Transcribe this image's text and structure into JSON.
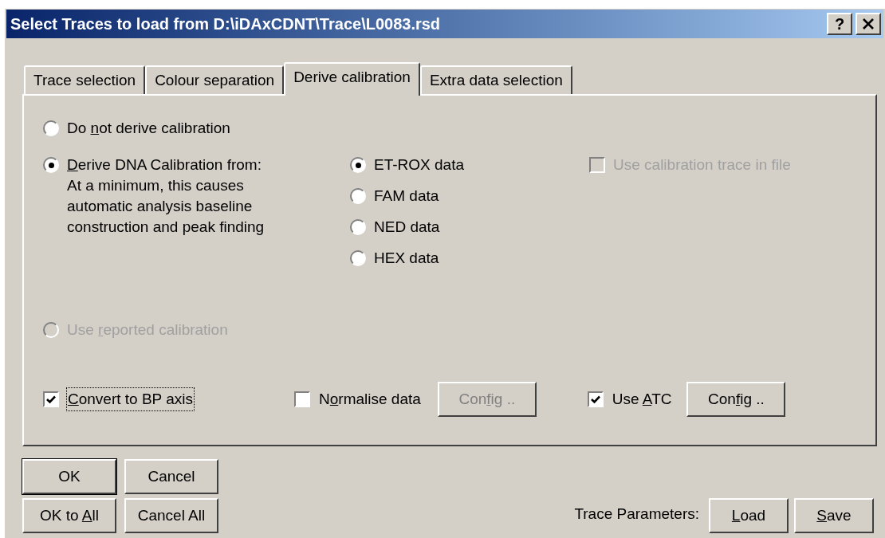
{
  "window": {
    "title": "Select Traces to load from D:\\iDAxCDNT\\Trace\\L0083.rsd",
    "help_button": "?"
  },
  "tabs": [
    {
      "label": "Trace selection",
      "selected": false
    },
    {
      "label": "Colour separation",
      "selected": false
    },
    {
      "label": "Derive calibration",
      "selected": true
    },
    {
      "label": "Extra data selection",
      "selected": false
    }
  ],
  "calibration_options": [
    {
      "label": {
        "pre": "Do ",
        "key": "n",
        "post": "ot derive calibration"
      },
      "selected": false,
      "disabled": false
    },
    {
      "label": {
        "key": "D",
        "post": "erive DNA Calibration from:"
      },
      "selected": true,
      "disabled": false
    },
    {
      "label": {
        "pre": "Use ",
        "key": "r",
        "post": "eported calibration"
      },
      "selected": false,
      "disabled": true
    }
  ],
  "derive_note": "At a minimum, this causes automatic analysis baseline construction and peak finding",
  "dye_options": [
    {
      "label": {
        "pre": "ET-ROX data"
      },
      "selected": true
    },
    {
      "label": {
        "pre": "FAM data"
      },
      "selected": false
    },
    {
      "label": {
        "pre": "NED data"
      },
      "selected": false
    },
    {
      "label": {
        "pre": "HEX data"
      },
      "selected": false
    }
  ],
  "use_calibration_trace": {
    "label": {
      "pre": "Use calibration trace in file"
    },
    "checked": false,
    "disabled": true
  },
  "bottom_row": [
    {
      "kind": "checkbox",
      "label": {
        "key": "C",
        "post": "onvert to BP axis"
      },
      "checked": true,
      "focused": true
    },
    {
      "kind": "checkbox",
      "label": {
        "pre": "N",
        "key": "o",
        "post": "rmalise data"
      },
      "checked": false,
      "focused": false
    },
    {
      "kind": "button",
      "label": {
        "pre": "Con",
        "key": "f",
        "post": "ig .."
      },
      "disabled": true
    },
    {
      "kind": "checkbox",
      "label": {
        "pre": "Use ",
        "key": "A",
        "post": "TC"
      },
      "checked": true,
      "focused": false
    },
    {
      "kind": "button",
      "label": {
        "pre": "Con",
        "key": "f",
        "post": "ig .."
      },
      "disabled": false
    }
  ],
  "dialog_buttons": [
    {
      "label": {
        "pre": "OK"
      },
      "default": true
    },
    {
      "label": {
        "pre": "Cancel"
      },
      "default": false
    },
    {
      "label": {
        "pre": "OK to ",
        "key": "A",
        "post": "ll"
      },
      "default": false
    },
    {
      "label": {
        "pre": "Cancel All"
      },
      "default": false
    }
  ],
  "trace_parameters": {
    "label": "Trace Parameters:",
    "buttons": [
      {
        "label": {
          "key": "L",
          "post": "oad"
        }
      },
      {
        "label": {
          "key": "S",
          "post": "ave"
        }
      }
    ]
  }
}
